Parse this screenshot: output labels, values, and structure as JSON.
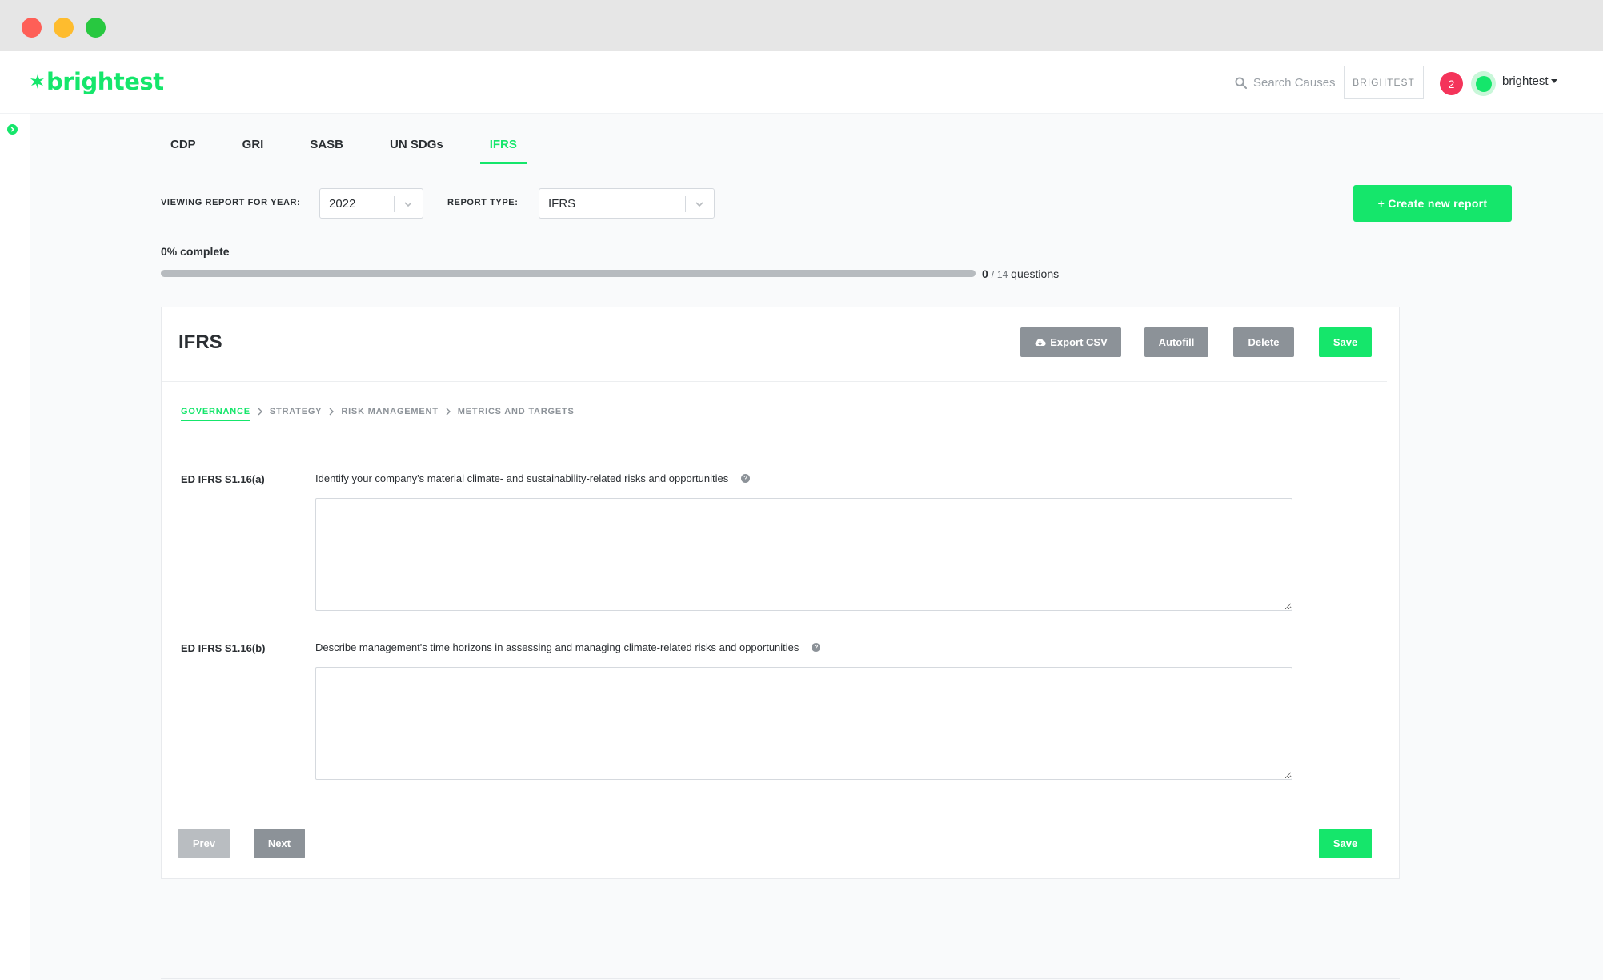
{
  "brand": {
    "name": "brightest",
    "accent": "#15e66b"
  },
  "header": {
    "search_label": "Search Causes",
    "org_button": "BRIGHTEST",
    "notification_count": "2",
    "username": "brightest"
  },
  "tabs": [
    {
      "label": "CDP",
      "active": false
    },
    {
      "label": "GRI",
      "active": false
    },
    {
      "label": "SASB",
      "active": false
    },
    {
      "label": "UN SDGs",
      "active": false
    },
    {
      "label": "IFRS",
      "active": true
    }
  ],
  "filters": {
    "year_label": "VIEWING REPORT FOR YEAR:",
    "year_value": "2022",
    "type_label": "REPORT TYPE:",
    "type_value": "IFRS",
    "create_button": "+ Create new report"
  },
  "progress": {
    "label": "0% complete",
    "fraction": 0,
    "answered": "0",
    "separator": "/",
    "total": "14",
    "unit": "questions"
  },
  "report": {
    "title": "IFRS",
    "buttons": {
      "export": "Export CSV",
      "autofill": "Autofill",
      "delete": "Delete",
      "save": "Save"
    },
    "steps": [
      {
        "label": "GOVERNANCE",
        "active": true
      },
      {
        "label": "STRATEGY",
        "active": false
      },
      {
        "label": "RISK MANAGEMENT",
        "active": false
      },
      {
        "label": "METRICS AND TARGETS",
        "active": false
      }
    ],
    "questions": [
      {
        "code": "ED IFRS S1.16(a)",
        "text": "Identify your company's material climate- and sustainability-related risks and opportunities",
        "answer": ""
      },
      {
        "code": "ED IFRS S1.16(b)",
        "text": "Describe management's time horizons in assessing and managing climate-related risks and opportunities",
        "answer": ""
      }
    ],
    "footer": {
      "prev": "Prev",
      "next": "Next",
      "save": "Save"
    }
  }
}
